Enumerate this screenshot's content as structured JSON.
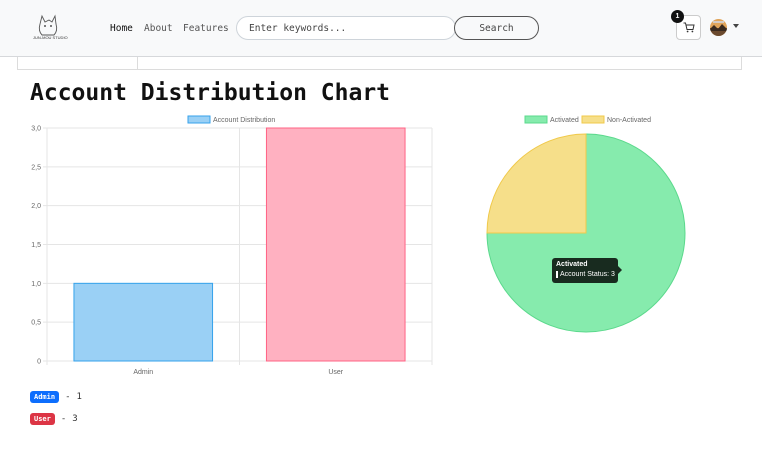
{
  "nav": {
    "logo_text": "JUN-MOU STUDIO",
    "links": [
      {
        "label": "Home",
        "active": true
      },
      {
        "label": "About",
        "active": false
      },
      {
        "label": "Features",
        "active": false
      }
    ],
    "search_placeholder": "Enter keywords...",
    "search_button": "Search",
    "cart_count": "1"
  },
  "page": {
    "title": "Account Distribution Chart"
  },
  "colors": {
    "admin_fill": "#9ad0f5",
    "admin_stroke": "#36a2eb",
    "user_fill": "#ffb1c1",
    "user_stroke": "#ff6384",
    "activated_fill": "#86ebad",
    "activated_stroke": "#5bd98c",
    "nonactivated_fill": "#f6df8a",
    "nonactivated_stroke": "#f0c94a",
    "admin_badge": "#0d6efd",
    "user_badge": "#dc3545"
  },
  "chart_data": [
    {
      "type": "bar",
      "legend": [
        "Account Distribution"
      ],
      "categories": [
        "Admin",
        "User"
      ],
      "series": [
        {
          "name": "Account Distribution",
          "values": [
            1,
            3
          ]
        }
      ],
      "ylim": [
        0,
        3
      ],
      "yticks": [
        "0",
        "0,5",
        "1,0",
        "1,5",
        "2,0",
        "2,5",
        "3,0"
      ],
      "grid": true
    },
    {
      "type": "pie",
      "legend": [
        "Activated",
        "Non-Activated"
      ],
      "labels": [
        "Activated",
        "Non-Activated"
      ],
      "values": [
        3,
        1
      ],
      "tooltip": {
        "title": "Activated",
        "body": "Account Status: 3"
      }
    }
  ],
  "account_legend": [
    {
      "label": "Admin",
      "separator": "-",
      "count": "1"
    },
    {
      "label": "User",
      "separator": "-",
      "count": "3"
    }
  ]
}
